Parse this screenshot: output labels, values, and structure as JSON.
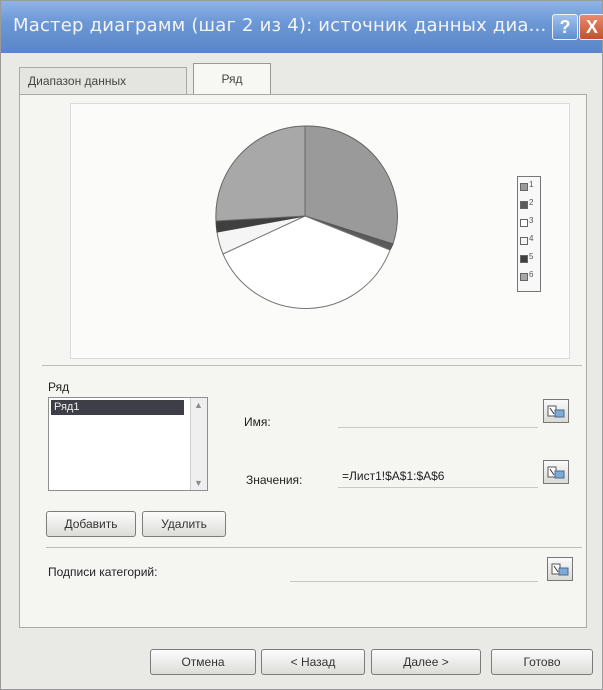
{
  "dialog": {
    "title": "Мастер диаграмм (шаг 2 из 4): источник данных диа...",
    "help_label": "?",
    "close_label": "X"
  },
  "tabs": [
    {
      "label": "Диапазон данных",
      "active": false
    },
    {
      "label": "Ряд",
      "active": true
    }
  ],
  "preview": {
    "pie_colors": [
      "#9a9a9a",
      "#5b5b5b",
      "#ffffff",
      "#f5f5f5",
      "#3f3f3f",
      "#a8a8a8"
    ],
    "legend": [
      "1",
      "2",
      "3",
      "4",
      "5",
      "6"
    ]
  },
  "series_section": {
    "label": "Ряд",
    "items": [
      "Ряд1"
    ],
    "add_label": "Добавить",
    "remove_label": "Удалить"
  },
  "fields": {
    "name_label": "Имя:",
    "name_value": "",
    "values_label": "Значения:",
    "values_value": "=Лист1!$A$1:$A$6",
    "categories_label": "Подписи категорий:",
    "categories_value": ""
  },
  "footer": {
    "cancel": "Отмена",
    "back": "< Назад",
    "next": "Далее >",
    "finish": "Готово"
  }
}
